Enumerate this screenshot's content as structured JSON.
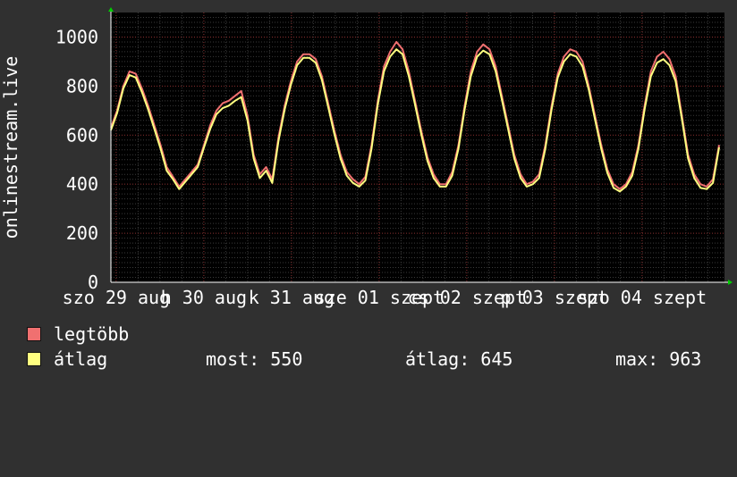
{
  "chart_data": {
    "type": "line",
    "ylabel": "onlinestream.live",
    "ylim": [
      0,
      1100
    ],
    "yticks": [
      0,
      200,
      400,
      600,
      800,
      1000
    ],
    "x_tick_labels": [
      "szo 29 aug",
      "h 30 aug",
      "k 31 aug",
      "sze 01 szept",
      "cs 02 szept",
      "p 03 szept",
      "szo 04 szept"
    ],
    "grid": true,
    "series": [
      {
        "name": "legtöbb",
        "color": "#f07070",
        "values": [
          630,
          700,
          800,
          860,
          850,
          790,
          720,
          640,
          560,
          470,
          430,
          390,
          420,
          450,
          480,
          560,
          640,
          700,
          730,
          740,
          760,
          780,
          680,
          520,
          440,
          470,
          420,
          590,
          720,
          820,
          900,
          930,
          930,
          910,
          840,
          730,
          620,
          520,
          450,
          420,
          400,
          430,
          560,
          740,
          880,
          940,
          980,
          950,
          860,
          740,
          620,
          510,
          440,
          400,
          400,
          450,
          560,
          720,
          860,
          940,
          970,
          950,
          880,
          760,
          640,
          520,
          440,
          400,
          410,
          440,
          560,
          720,
          850,
          920,
          950,
          940,
          900,
          800,
          680,
          560,
          460,
          400,
          380,
          400,
          450,
          560,
          720,
          860,
          920,
          940,
          910,
          840,
          680,
          520,
          440,
          400,
          390,
          420,
          560
        ]
      },
      {
        "name": "átlag",
        "color": "#ffff80",
        "values": [
          620,
          690,
          790,
          845,
          835,
          775,
          705,
          625,
          545,
          455,
          420,
          380,
          410,
          440,
          470,
          550,
          625,
          685,
          710,
          720,
          740,
          755,
          660,
          505,
          425,
          455,
          405,
          575,
          705,
          805,
          885,
          915,
          915,
          895,
          825,
          715,
          605,
          505,
          435,
          405,
          390,
          415,
          545,
          725,
          860,
          920,
          950,
          930,
          840,
          725,
          605,
          495,
          425,
          390,
          390,
          435,
          545,
          705,
          840,
          920,
          945,
          930,
          860,
          745,
          625,
          505,
          425,
          390,
          400,
          425,
          545,
          705,
          835,
          900,
          930,
          920,
          880,
          785,
          665,
          545,
          445,
          385,
          370,
          390,
          435,
          545,
          705,
          840,
          895,
          910,
          885,
          820,
          665,
          505,
          425,
          385,
          380,
          405,
          550
        ]
      }
    ]
  },
  "legend": [
    {
      "label": "legtöbb",
      "color": "#f07070"
    },
    {
      "label": "átlag",
      "color": "#ffff80"
    }
  ],
  "stats": {
    "most": "most: 550",
    "atlag": "átlag: 645",
    "max": "max: 963"
  }
}
